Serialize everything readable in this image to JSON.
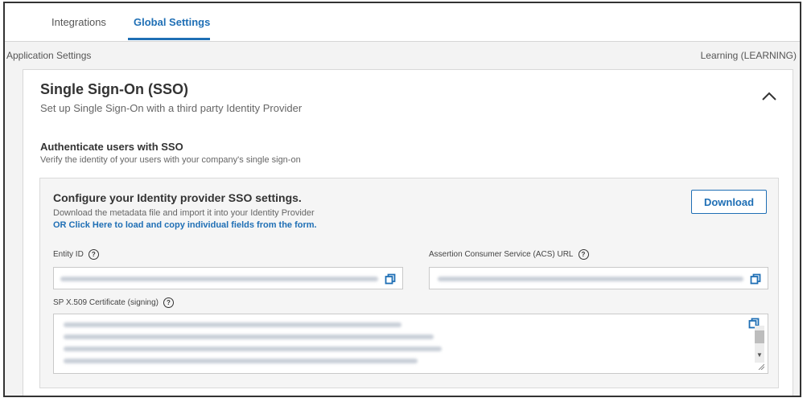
{
  "tabs": {
    "integrations": "Integrations",
    "global_settings": "Global Settings"
  },
  "header": {
    "section_label": "Application Settings",
    "environment": "Learning (LEARNING)"
  },
  "sso": {
    "title": "Single Sign-On (SSO)",
    "subtitle": "Set up Single Sign-On with a third party Identity Provider",
    "auth_title": "Authenticate users with SSO",
    "auth_subtitle": "Verify the identity of your users with your company's single sign-on"
  },
  "config": {
    "title": "Configure your Identity provider SSO settings.",
    "subtitle": "Download the metadata file and import it into your Identity Provider",
    "link": "OR Click Here to load and copy individual fields from the form.",
    "download_label": "Download"
  },
  "fields": {
    "entity_id_label": "Entity ID",
    "acs_url_label": "Assertion Consumer Service (ACS) URL",
    "certificate_label": "SP X.509 Certificate (signing)"
  },
  "colors": {
    "accent": "#1f6fb5",
    "background": "#f3f3f3",
    "card": "#ffffff"
  },
  "icons": {
    "copy": "copy-icon",
    "help": "help-icon",
    "collapse": "chevron-up-icon"
  }
}
